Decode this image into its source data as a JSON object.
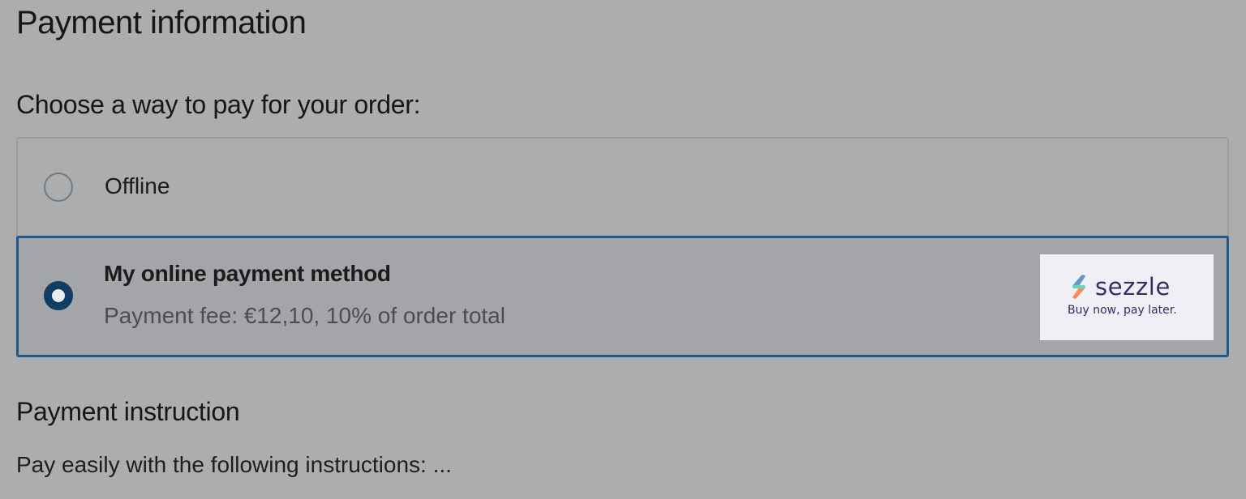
{
  "page": {
    "title": "Payment information"
  },
  "payment": {
    "heading": "Choose a way to pay for your order:",
    "options": [
      {
        "label": "Offline",
        "selected": false
      },
      {
        "label": "My online payment method",
        "fee": "Payment fee: €12,10, 10% of order total",
        "selected": true,
        "logo": {
          "icon": "sezzle-logo-icon",
          "wordmark": "sezzle",
          "tagline": "Buy now, pay later."
        }
      }
    ]
  },
  "instruction": {
    "heading": "Payment instruction",
    "text": "Pay easily with the following instructions: ..."
  },
  "colors": {
    "background": "#adadad",
    "selected_border": "#1a5a8c",
    "radio_checked": "#0f3d63",
    "logo_text": "#3b2a6b"
  }
}
